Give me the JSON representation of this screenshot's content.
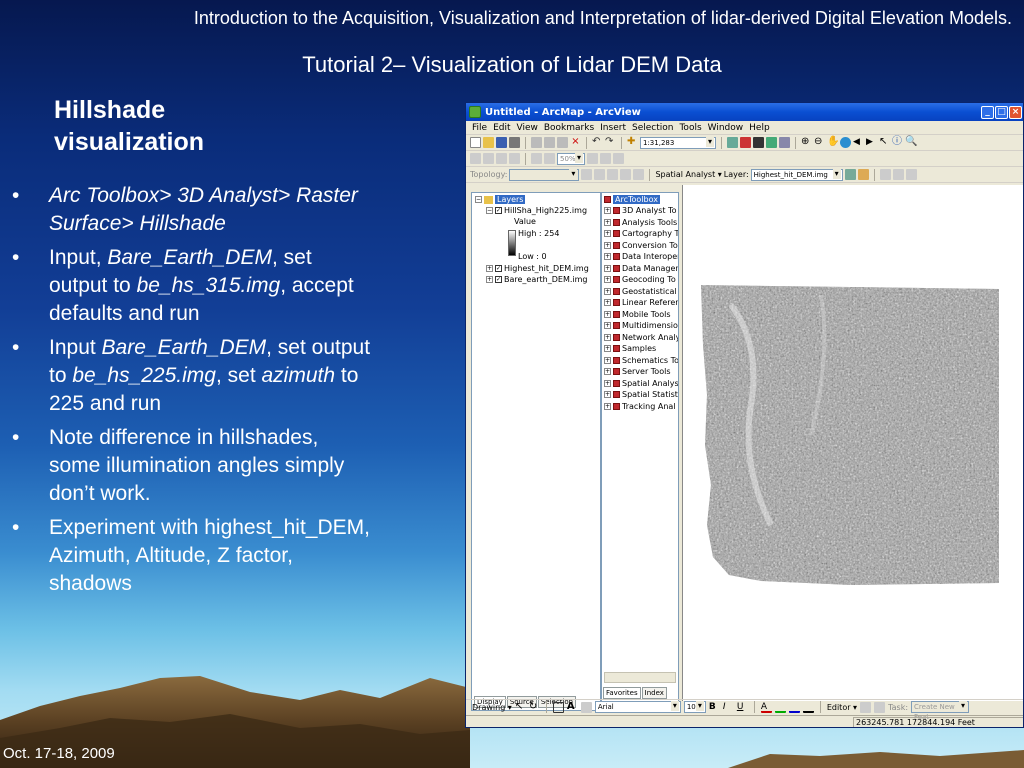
{
  "slide": {
    "header_title": "Introduction to the Acquisition, Visualization and Interpretation of lidar-derived Digital Elevation Models.",
    "subtitle": "Tutorial 2– Visualization of Lidar DEM Data",
    "section_title": "Hillshade visualization",
    "bullet_char": "•",
    "bullets": [
      {
        "text_a": "Arc Toolbox>  3D Analyst> Raster Surface> Hillshade"
      },
      {
        "pre": "Input, ",
        "i1": "Bare_Earth_DEM",
        "mid1": ", set output to ",
        "i2": "be_hs_315.img",
        "post": ", accept defaults and run"
      },
      {
        "pre": "Input ",
        "i1": "Bare_Earth_DEM",
        "mid1": ", set output to ",
        "i2": "be_hs_225.img",
        "mid2": ", set ",
        "i3": "azimuth",
        "post": " to 225 and run"
      },
      {
        "text": "Note difference in hillshades, some illumination angles simply don’t work."
      },
      {
        "text": "Experiment with highest_hit_DEM, Azimuth, Altitude, Z factor, shadows"
      }
    ],
    "footer_date": "Oct. 17-18, 2009"
  },
  "arcmap": {
    "title": "Untitled - ArcMap - ArcView",
    "menu": [
      "File",
      "Edit",
      "View",
      "Bookmarks",
      "Insert",
      "Selection",
      "Tools",
      "Window",
      "Help"
    ],
    "scale_value": "1:31,283",
    "zoom_value": "50%",
    "topology_label": "Topology:",
    "spatial_analyst_label": "Spatial Analyst ▾",
    "layer_label": "Layer:",
    "layer_value": "Highest_hit_DEM.img",
    "toc": {
      "root": "Layers",
      "layer1": "HillSha_High225.img",
      "value_label": "Value",
      "high_label": "High : 254",
      "low_label": "Low : 0",
      "layer2": "Highest_hit_DEM.img",
      "layer3": "Bare_earth_DEM.img",
      "tabs": [
        "Display",
        "Source",
        "Selection"
      ]
    },
    "toolbox": {
      "root": "ArcToolbox",
      "items": [
        "3D Analyst To",
        "Analysis Tools",
        "Cartography T",
        "Conversion To",
        "Data Interoper",
        "Data Managen",
        "Geocoding To",
        "Geostatistical A",
        "Linear Referen",
        "Mobile Tools",
        "Multidimensio",
        "Network Analy",
        "Samples",
        "Schematics To",
        "Server Tools",
        "Spatial Analys",
        "Spatial Statisti",
        "Tracking Anal"
      ],
      "tabs": [
        "Favorites",
        "Index"
      ]
    },
    "draw": {
      "drawing_label": "Drawing ▾",
      "font_value": "Arial",
      "size_value": "10",
      "editor_label": "Editor ▾",
      "task_label": "Task:",
      "task_value": "Create New Feat"
    },
    "status_coords": "263245.781  172844.194 Feet"
  },
  "colors": {
    "title_bar": "#0a4fd2",
    "selection": "#316ac5",
    "toolbox_icon": "#c0282d"
  }
}
